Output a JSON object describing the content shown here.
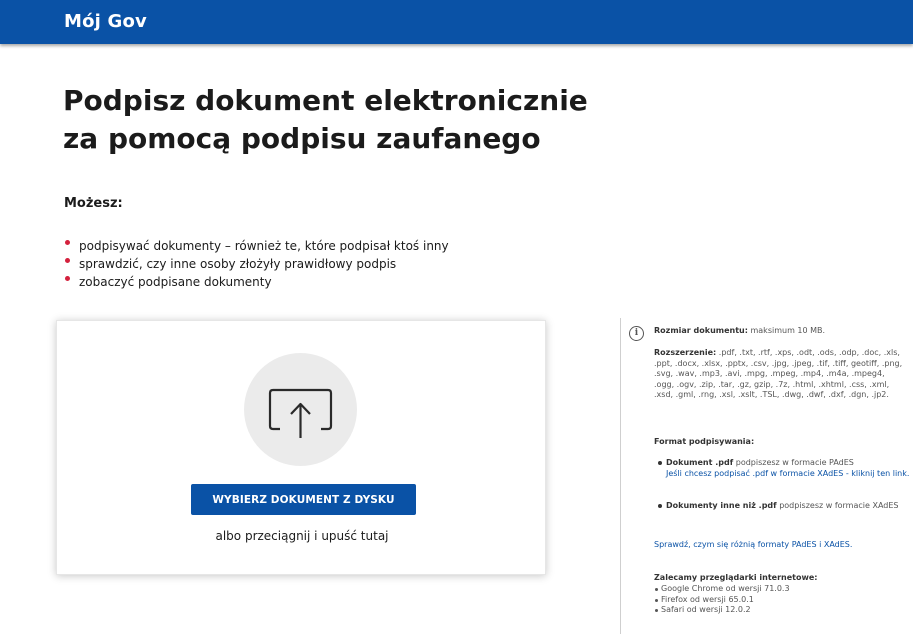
{
  "header": {
    "brand": "Mój Gov",
    "bar_color": "#0a52a6"
  },
  "main": {
    "title_line1": "Podpisz dokument elektronicznie",
    "title_line2": "za pomocą podpisu zaufanego",
    "can_heading": "Możesz:",
    "features": [
      "podpisywać dokumenty – również te, które podpisał ktoś inny",
      "sprawdzić, czy inne osoby złożyły prawidłowy podpis",
      "zobaczyć podpisane dokumenty"
    ],
    "bullet_color": "#d4213d"
  },
  "upload": {
    "icon": "upload-icon",
    "button_label": "WYBIERZ DOKUMENT Z DYSKU",
    "drop_hint": "albo przeciągnij i upuść tutaj"
  },
  "sidebar": {
    "icon": "info-icon",
    "size_label": "Rozmiar dokumentu:",
    "size_value": "maksimum 10 MB.",
    "ext_label": "Rozszerzenie:",
    "ext_value": ".pdf, .txt, .rtf, .xps, .odt, .ods, .odp, .doc, .xls, .ppt, .docx, .xlsx, .pptx, .csv, .jpg, .jpeg, .tif, .tiff, geotiff, .png, .svg, .wav, .mp3, .avi, .mpg, .mpeg, .mp4, .m4a, .mpeg4, .ogg, .ogv, .zip, .tar, .gz, gzip, .7z, .html, .xhtml, .css, .xml, .xsd, .gml, .rng, .xsl, .xslt, .TSL, .dwg, .dwf, .dxf, .dgn, .jp2.",
    "format_heading": "Format podpisywania:",
    "pdf_bold": "Dokument .pdf",
    "pdf_text": "podpiszesz w formacie PAdES",
    "pdf_link": "Jeśli chcesz podpisać .pdf w formacie XAdES - kliknij ten link.",
    "other_bold": "Dokumenty inne niż .pdf",
    "other_text": "podpiszesz w formacie XAdES",
    "compare_link": "Sprawdź, czym się różnią formaty PAdES i XAdES.",
    "browsers_heading": "Zalecamy przeglądarki internetowe:",
    "browsers": [
      "Google Chrome od wersji 71.0.3",
      "Firefox od wersji 65.0.1",
      "Safari od wersji 12.0.2"
    ]
  }
}
